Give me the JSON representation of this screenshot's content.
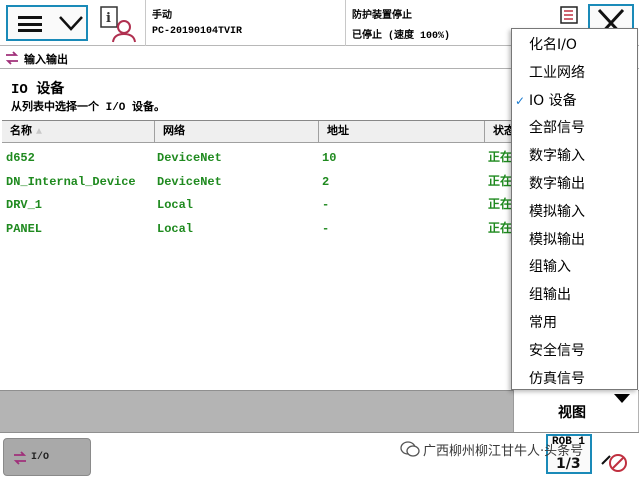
{
  "header": {
    "mode": "手动",
    "host": "PC-20190104TVIR",
    "safety": "防护装置停止",
    "state": "已停止 (速度 100%)"
  },
  "app": {
    "title": "输入输出"
  },
  "view": {
    "title": "IO 设备",
    "subtitle": "从列表中选择一个 I/O 设备。"
  },
  "table": {
    "columns": [
      "名称",
      "网络",
      "地址",
      "状态"
    ],
    "sort_indicator": "▲",
    "rows": [
      [
        "d652",
        "DeviceNet",
        "10",
        "正在"
      ],
      [
        "DN_Internal_Device",
        "DeviceNet",
        "2",
        "正在"
      ],
      [
        "DRV_1",
        "Local",
        "-",
        "正在"
      ],
      [
        "PANEL",
        "Local",
        "-",
        "正在"
      ]
    ],
    "text_color": "#1f8a1f"
  },
  "dropdown": {
    "items": [
      {
        "label": "化名I/O",
        "checked": false
      },
      {
        "label": "工业网络",
        "checked": false
      },
      {
        "label": "IO 设备",
        "checked": true
      },
      {
        "label": "全部信号",
        "checked": false
      },
      {
        "label": "数字输入",
        "checked": false
      },
      {
        "label": "数字输出",
        "checked": false
      },
      {
        "label": "模拟输入",
        "checked": false
      },
      {
        "label": "模拟输出",
        "checked": false
      },
      {
        "label": "组输入",
        "checked": false
      },
      {
        "label": "组输出",
        "checked": false
      },
      {
        "label": "常用",
        "checked": false
      },
      {
        "label": "安全信号",
        "checked": false
      },
      {
        "label": "仿真信号",
        "checked": false
      }
    ],
    "check_glyph": "✓"
  },
  "toolbar": {
    "view_label": "视图"
  },
  "taskbar": {
    "io_label": "I/O",
    "quickset_label": "ROB_1",
    "quickset_fraction": "1/3",
    "watermark": "广西柳州柳江甘牛人·头条号"
  },
  "colors": {
    "accent": "#1a8ab8",
    "toolbar_bg": "#b4b4b4",
    "task_bg": "#a9a9a9"
  },
  "icons": [
    "menu-icon",
    "chevron-down-icon",
    "user-info-icon",
    "event-log-icon",
    "close-icon",
    "io-icon",
    "quickset-icon",
    "wechat-icon"
  ]
}
